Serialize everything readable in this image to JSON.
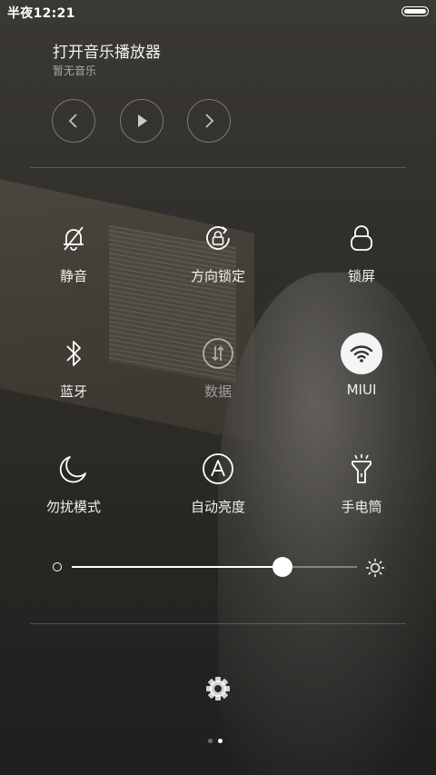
{
  "status_bar": {
    "time": "半夜12:21"
  },
  "music": {
    "title": "打开音乐播放器",
    "subtitle": "暂无音乐",
    "controls": [
      "previous-icon",
      "play-icon",
      "next-icon"
    ]
  },
  "toggles": [
    {
      "label": "静音",
      "icon": "mute-bell-icon",
      "active": false
    },
    {
      "label": "方向锁定",
      "icon": "rotation-lock-icon",
      "active": false
    },
    {
      "label": "锁屏",
      "icon": "lock-icon",
      "active": false
    },
    {
      "label": "蓝牙",
      "icon": "bluetooth-icon",
      "active": false
    },
    {
      "label": "数据",
      "icon": "mobile-data-icon",
      "active": false,
      "dimmed": true
    },
    {
      "label": "MIUI",
      "icon": "wifi-icon",
      "active": true
    },
    {
      "label": "勿扰模式",
      "icon": "moon-icon",
      "active": false
    },
    {
      "label": "自动亮度",
      "icon": "auto-brightness-icon",
      "active": false
    },
    {
      "label": "手电筒",
      "icon": "flashlight-icon",
      "active": false
    }
  ],
  "brightness": {
    "value_fraction": 0.74
  },
  "pager": {
    "page_count": 2,
    "current_page": 2
  },
  "colors": {
    "active_toggle_bg": "#f4f4f4",
    "text": "#ffffff",
    "subtext": "#a8a8a8"
  }
}
